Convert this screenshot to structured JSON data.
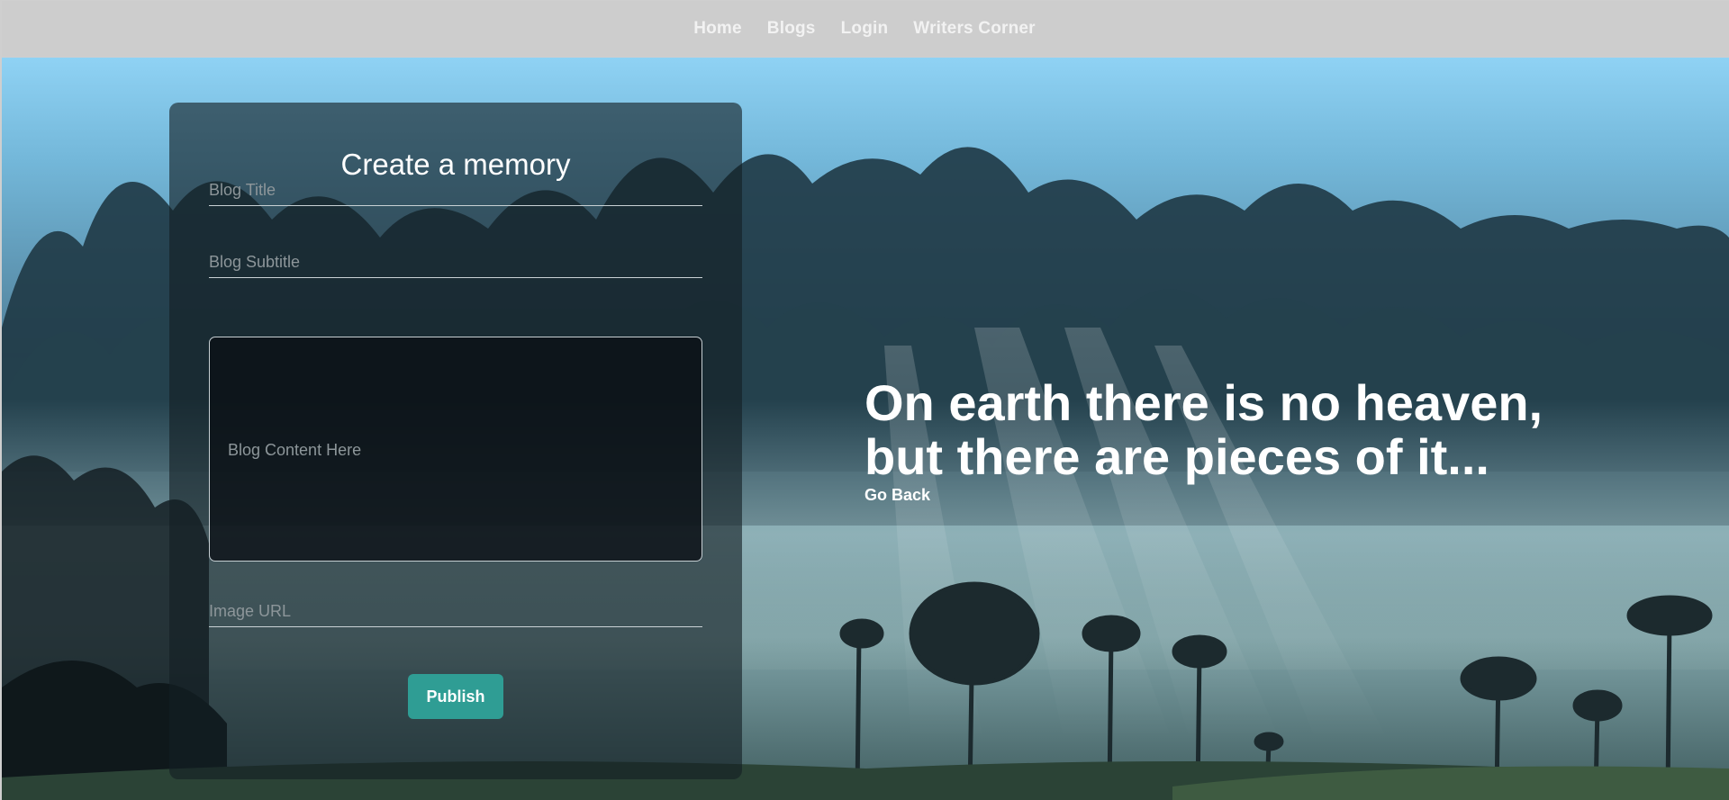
{
  "nav": {
    "links": [
      "Home",
      "Blogs",
      "Login",
      "Writers Corner"
    ]
  },
  "form": {
    "title": "Create a memory",
    "title_placeholder": "Blog Title",
    "subtitle_placeholder": "Blog Subtitle",
    "content_placeholder": "Blog Content Here",
    "image_placeholder": "Image URL",
    "publish_label": "Publish"
  },
  "hero": {
    "quote_line1": "On earth there is no heaven,",
    "quote_line2": "but there are pieces of it...",
    "go_back_label": "Go Back"
  },
  "colors": {
    "navbar_bg": "#cdcdcd",
    "publish_button": "#2f9d94",
    "panel_bg": "rgba(20,30,36,0.62)"
  }
}
